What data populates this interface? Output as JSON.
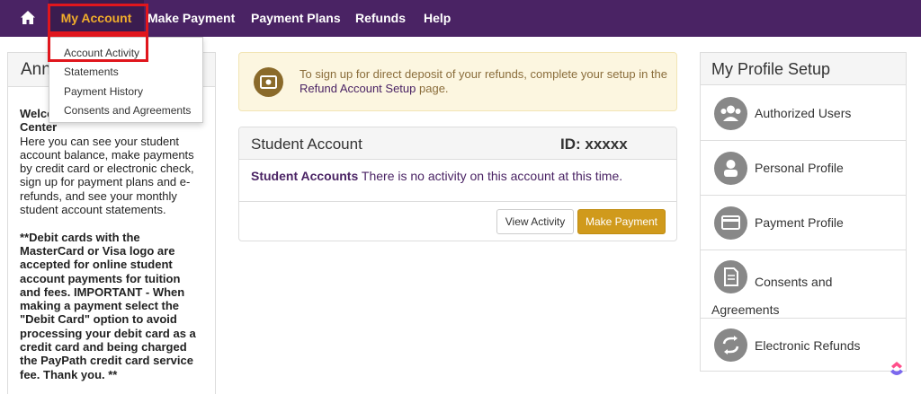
{
  "nav": {
    "items": [
      "My Account",
      "Make Payment",
      "Payment Plans",
      "Refunds",
      "Help"
    ],
    "home_icon": "home-icon",
    "background": "#4a2364",
    "active_color": "#f0ad2b"
  },
  "dropdown": {
    "items": [
      "Account Activity",
      "Statements",
      "Payment History",
      "Consents and Agreements"
    ]
  },
  "announcements": {
    "title": "Announcements",
    "welcome_heading": "Welcome to the Student Account Center",
    "welcome_text": "Here you can see your student account balance, make payments by credit card or electronic check, sign up for payment plans and e-refunds, and see your monthly student account statements.",
    "debit_note": "**Debit cards with the MasterCard or Visa logo are accepted for online student account payments for tuition and fees. IMPORTANT - When making a payment select the \"Debit Card\" option to avoid processing your debit card as a credit card and being charged the PayPath credit card service fee. Thank you. **"
  },
  "notice": {
    "text_before": "To sign up for direct deposit of your refunds, complete your setup in the",
    "link": "Refund Account Setup",
    "text_after": "page.",
    "icon": "cash-icon"
  },
  "account": {
    "title": "Student Account",
    "id_label": "ID: xxxxx",
    "msg_bold": "Student Accounts",
    "msg_text": "There is no activity on this account at this time.",
    "view_label": "View Activity",
    "pay_label": "Make Payment",
    "pay_color": "#d09a1c"
  },
  "profile": {
    "title": "My Profile Setup",
    "items": [
      "Authorized Users",
      "Personal Profile",
      "Payment Profile",
      "Consents and Agreements",
      "Electronic Refunds"
    ],
    "icons": [
      "users-icon",
      "person-icon",
      "credit-card-icon",
      "document-icon",
      "refresh-icon"
    ]
  }
}
